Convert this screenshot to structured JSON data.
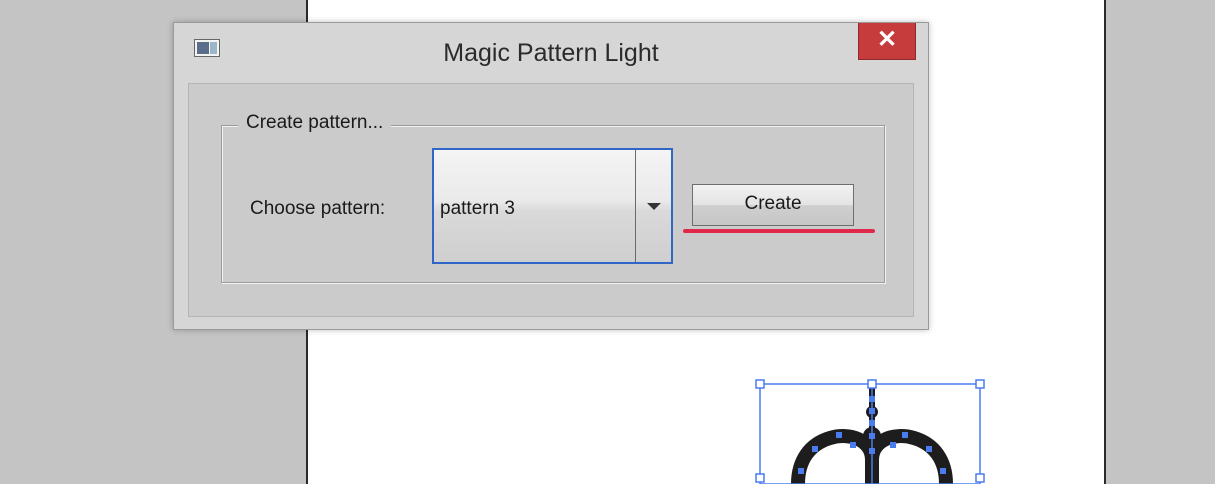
{
  "dialog": {
    "title": "Magic Pattern Light",
    "close_glyph": "✕",
    "group": {
      "legend": "Create pattern...",
      "choose_label": "Choose pattern:",
      "dropdown": {
        "selected": "pattern 3"
      },
      "create_label": "Create"
    }
  },
  "icons": {
    "app": "window-app-icon",
    "close": "close-icon",
    "dropdown": "chevron-down-icon"
  },
  "colors": {
    "close_button": "#c63b3b",
    "focus_border": "#2f66c8",
    "annotation_underline": "#e0284b",
    "selection": "#4a7cf0"
  }
}
